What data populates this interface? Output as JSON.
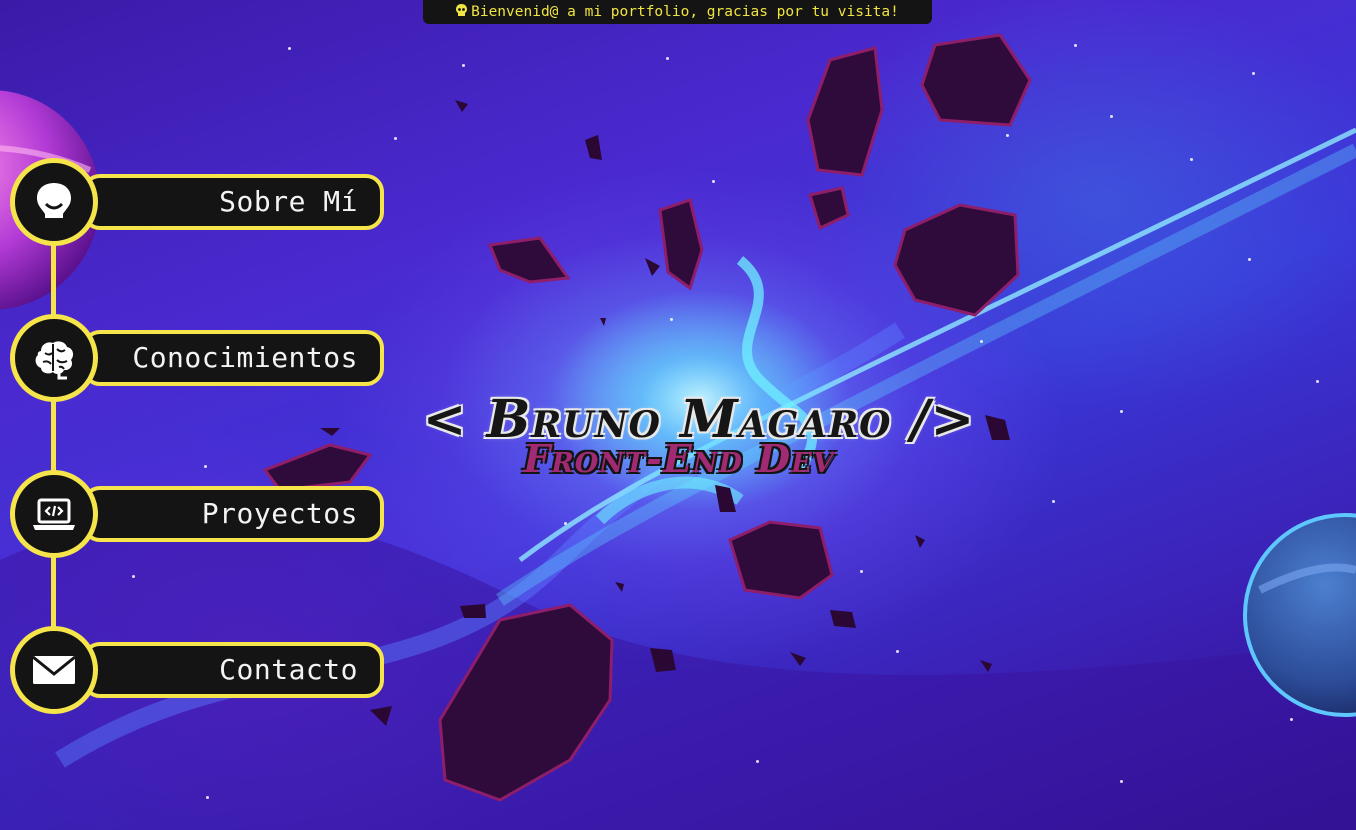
{
  "notice": {
    "icon": "skull-icon",
    "text": "Bienvenid@ a mi portfolio, gracias por tu visita!"
  },
  "hero": {
    "title": "< Bruno Magaro />",
    "subtitle": "Front-End Dev"
  },
  "nav": {
    "items": [
      {
        "label": "Sobre Mí",
        "icon": "alien-icon"
      },
      {
        "label": "Conocimientos",
        "icon": "brain-icon"
      },
      {
        "label": "Proyectos",
        "icon": "laptop-code-icon"
      },
      {
        "label": "Contacto",
        "icon": "envelope-icon"
      }
    ]
  },
  "colors": {
    "accent": "#f5e44a",
    "panel": "#141414",
    "subtitle": "#a22a72",
    "space": "#3b1fb3"
  }
}
